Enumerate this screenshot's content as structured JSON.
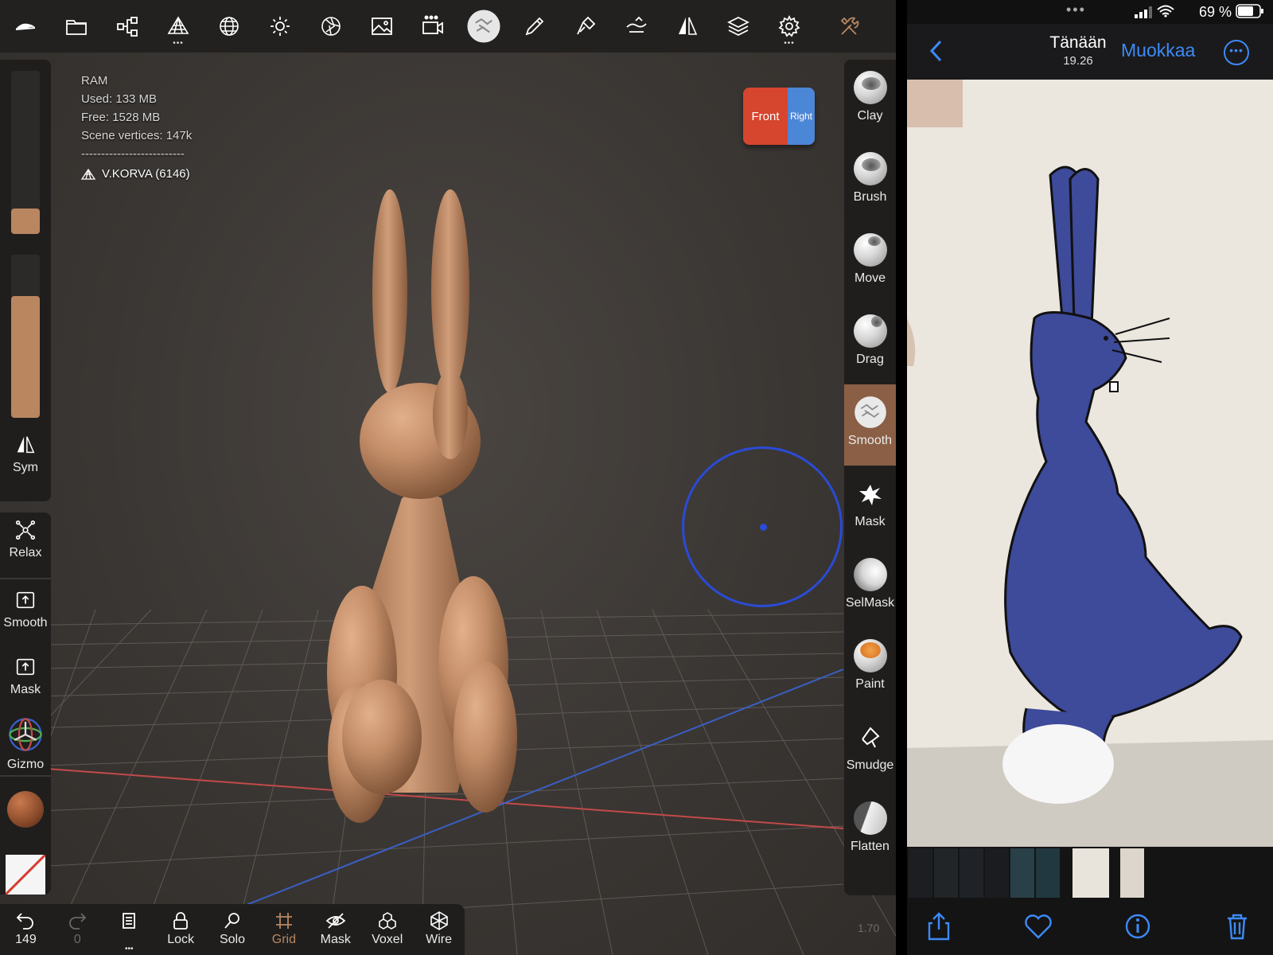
{
  "app": {
    "toolbar_icons": [
      "logo-icon",
      "folder-icon",
      "scene-graph-icon",
      "topology-icon",
      "sphere-grid-icon",
      "light-icon",
      "material-icon",
      "image-icon",
      "camera-icon",
      "brush-preview-icon",
      "pen-icon",
      "paint-icon",
      "painting-icon",
      "symmetry-icon",
      "layers-icon",
      "settings-icon",
      "tools-icon"
    ]
  },
  "info": {
    "ram_label": "RAM",
    "used": "Used: 133 MB",
    "free": "Free: 1528 MB",
    "vertices": "Scene vertices: 147k",
    "separator": "--------------------------",
    "object": "V.KORVA (6146)"
  },
  "view_cube": {
    "front": "Front",
    "right": "Right"
  },
  "left_sidebar": {
    "radius_fraction": 0.0,
    "intensity_fraction": 0.7,
    "sym_label": "Sym"
  },
  "left_tools": {
    "relax": "Relax",
    "smooth": "Smooth",
    "mask": "Mask",
    "gizmo": "Gizmo"
  },
  "right_tools": {
    "items": [
      {
        "label": "Clay"
      },
      {
        "label": "Brush"
      },
      {
        "label": "Move"
      },
      {
        "label": "Drag"
      },
      {
        "label": "Smooth",
        "active": true
      },
      {
        "label": "Mask"
      },
      {
        "label": "SelMask"
      },
      {
        "label": "Paint"
      },
      {
        "label": "Smudge"
      },
      {
        "label": "Flatten"
      }
    ]
  },
  "bottom_toolbar": {
    "undo_count": "149",
    "redo_count": "0",
    "lock": "Lock",
    "solo": "Solo",
    "grid": "Grid",
    "mask": "Mask",
    "voxel": "Voxel",
    "wire": "Wire"
  },
  "zoom_readout": "1.70",
  "colors": {
    "accent": "#b98660",
    "brush_cursor": "#2a4bd6",
    "ios_blue": "#3d8af7"
  },
  "photos": {
    "battery": "69 %",
    "title": "Tänään",
    "time": "19.26",
    "edit": "Muokkaa"
  }
}
